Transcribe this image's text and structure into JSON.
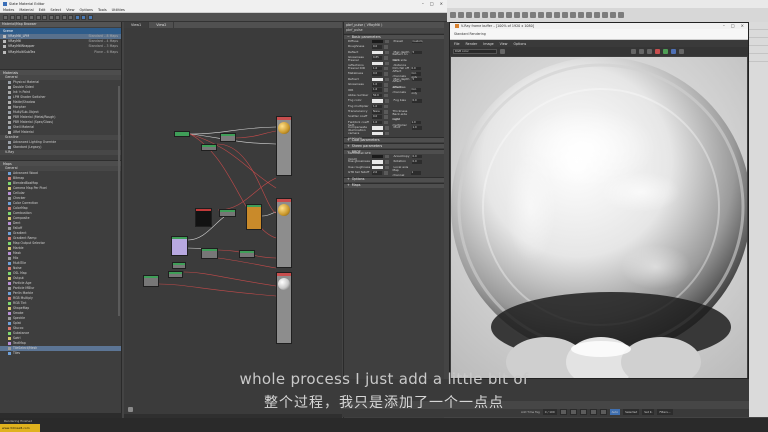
{
  "sme": {
    "window_title": "Slate Material Editor",
    "menus": [
      "Modes",
      "Material",
      "Edit",
      "Select",
      "View",
      "Options",
      "Tools",
      "Utilities"
    ],
    "browser_title": "Material/Map Browser",
    "scene_section": "Scene",
    "scene_items": [
      {
        "label": "VRayMtl_LPM",
        "right": "Standard – 8 Maps"
      },
      {
        "label": "VRayMtl",
        "right": "Standard – 4 Maps"
      },
      {
        "label": "VRayMtlWrapper",
        "right": "Standard – 3 Maps"
      },
      {
        "label": "VRayMultiSubTex",
        "right": "Plane – 6 Maps"
      }
    ],
    "materials_header": "Materials",
    "general_label": "General",
    "materials": [
      "Physical Material",
      "Double Sided",
      "Ink 'n Paint",
      "LPM Shader Switcher",
      "Matte/Shadow",
      "Morpher",
      "Multi/Sub-Object",
      "PBR Material (Metal/Rough)",
      "PBR Material (Spec/Gloss)",
      "Shell Material",
      "XRef Material"
    ],
    "scanline_label": "Scanline",
    "scanline_items": [
      "Advanced Lighting Override",
      "Standard (Legacy)"
    ],
    "vray_label": "V-Ray",
    "maps_header": "Maps",
    "maps": [
      "Advanced Wood",
      "Bitmap",
      "BlendedBoxMap",
      "Camera Map Per Pixel",
      "Cellular",
      "Checker",
      "Color Correction",
      "ColorMap",
      "Combustion",
      "Composite",
      "Dent",
      "Falloff",
      "Gradient",
      "Gradient Ramp",
      "Map Output Selector",
      "Marble",
      "Mask",
      "Mix",
      "MultiTile",
      "Noise",
      "OSL Map",
      "Output",
      "Particle Age",
      "Particle MBlur",
      "Perlin Marble",
      "RGB Multiply",
      "RGB Tint",
      "ShapeMap",
      "Smoke",
      "Speckle",
      "Splat",
      "Stucco",
      "Substance",
      "Swirl",
      "TextMap",
      "TileSelect/Mesh",
      "Tiles"
    ],
    "view_tabs": [
      "View1",
      "View2"
    ],
    "params_header": "pbrf_pulse ( VRayMtl )",
    "params_sub": "pbrf_pulse",
    "basic_params": "Basic parameters",
    "params": [
      {
        "l1": "Diffuse",
        "l2": "Preset",
        "v2": "Custom"
      },
      {
        "l1": "Roughness",
        "v1": "0.0"
      },
      {
        "l1": "Reflect",
        "l2": "Max depth",
        "v2": "5"
      },
      {
        "l1": "Glossiness",
        "v1": "0.85",
        "l2": "Reflect on back side"
      },
      {
        "l1": "Fresnel reflections",
        "l2": "Dim distance"
      },
      {
        "l1": "Fresnel IOR",
        "v1": "1.6",
        "l2": "Dim fall off",
        "v2": "0.0"
      },
      {
        "l1": "Metalness",
        "v1": "0.0",
        "l2": "Affect channels",
        "v2": "Col. only"
      },
      {
        "l1": "Refract",
        "l2": "Max depth",
        "v2": "5"
      },
      {
        "l1": "Glossiness",
        "v1": "1.0",
        "l2": "Affect shadows"
      },
      {
        "l1": "IOR",
        "v1": "1.6",
        "l2": "Affect channels",
        "v2": "Col. only"
      },
      {
        "l1": "Abbe number",
        "v1": "50.0"
      },
      {
        "l1": "Fog color",
        "l2": "Fog bias",
        "v2": "0.0"
      },
      {
        "l1": "Fog multiplier",
        "v1": "1.0"
      },
      {
        "l1": "Translucency",
        "v1": "None",
        "l2": "Thickness"
      },
      {
        "l1": "Scatter coeff",
        "v1": "0.0",
        "l2": "Back-side color"
      },
      {
        "l1": "Fwd/bck coeff",
        "v1": "1.0",
        "l2": "Light multiplier",
        "v2": "1.0"
      },
      {
        "l1": "Self-illumination",
        "l2": "Mult",
        "v2": "1.0"
      },
      {
        "l1": "Compensate camera exposure"
      }
    ],
    "coat_params": "Coat parameters",
    "sheen_params": "Sheen parameters",
    "brdf": "BRDF",
    "brdf_rows": [
      {
        "l1": "Microfacet GTR (GGX)",
        "l2": "Anisotropy",
        "v2": "0.0"
      },
      {
        "l1": "Use glossiness",
        "l2": "Rotation",
        "v2": "0.0"
      },
      {
        "l1": "Use roughness",
        "l2": "Local axis"
      },
      {
        "l1": "GTR tail falloff",
        "v1": "2.0",
        "l2": "Map channel",
        "v2": "1"
      }
    ],
    "options_roll": "Options",
    "maps_roll": "Maps"
  },
  "vfb": {
    "title": "V-Ray frame buffer – [100% of 1920 x 1080]",
    "sub_items": [
      "Standard Rendering"
    ],
    "menus": [
      "File",
      "Render",
      "Image",
      "View",
      "Options"
    ],
    "channel": "RGB color"
  },
  "subtitle_en": "whole process I just add a little bit of",
  "subtitle_cn": "整个过程，我只是添加了一个一点点",
  "timeline": {
    "frame": "0 / 100",
    "labels": [
      "Auto",
      "Selected",
      "Set K.",
      "Filters..."
    ],
    "grid_label": "Add Time Tag"
  },
  "status": {
    "brand": "www.3dmax8.com",
    "text": "Rendering finished"
  },
  "colors": {
    "accent": "#4b7bb5",
    "scene_bg": "#2e5c8a",
    "node_header_green": "#3f9e58",
    "node_orange": "#c98a2a"
  }
}
